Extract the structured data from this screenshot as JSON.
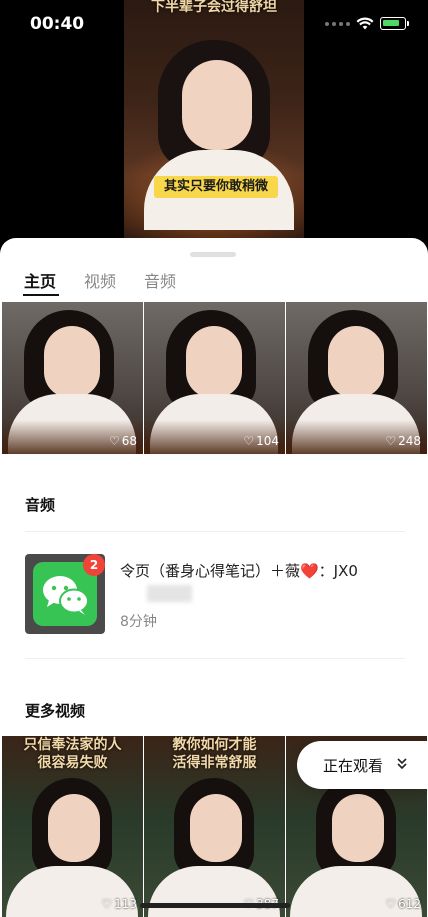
{
  "status_bar": {
    "time": "00:40"
  },
  "video": {
    "caption_top": "下半辈子会过得舒坦",
    "subtitle": "其实只要你敢稍微"
  },
  "tabs": [
    {
      "label": "主页",
      "active": true
    },
    {
      "label": "视频",
      "active": false
    },
    {
      "label": "音频",
      "active": false
    }
  ],
  "thumbnails": [
    {
      "likes": "68"
    },
    {
      "likes": "104"
    },
    {
      "likes": "248"
    }
  ],
  "audio_section": {
    "title": "音频",
    "item": {
      "title": "令页（番身心得笔记）＋薇❤️：JX0",
      "duration": "8分钟",
      "badge": "2"
    }
  },
  "more_videos": {
    "title": "更多视频",
    "items": [
      {
        "caption_line1": "只信奉法家的人",
        "caption_line2": "很容易失败",
        "likes": "113"
      },
      {
        "caption_line1": "教你如何才能",
        "caption_line2": "活得非常舒服",
        "likes": "387"
      },
      {
        "caption_line1": "",
        "caption_line2": "",
        "likes": "612"
      }
    ]
  },
  "now_watching": {
    "label": "正在观看"
  },
  "colors": {
    "accent_green": "#37c454",
    "badge_red": "#f0433a"
  },
  "icons": [
    "wifi-icon",
    "battery-icon",
    "heart-icon",
    "wechat-icon",
    "chevron-down-icon"
  ]
}
